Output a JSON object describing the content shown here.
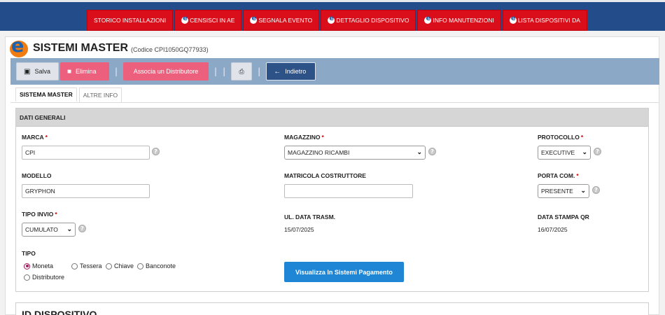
{
  "nav": [
    {
      "label": "STORICO INSTALLAZIONI",
      "has_logo": false
    },
    {
      "label": "CENSISCI IN AE",
      "has_logo": true
    },
    {
      "label": "SEGNALA EVENTO",
      "has_logo": true
    },
    {
      "label": "DETTAGLIO DISPOSITIVO",
      "has_logo": true
    },
    {
      "label": "INFO MANUTENZIONI",
      "has_logo": true
    },
    {
      "label": "LISTA DISPOSITIVI DA",
      "has_logo": true
    }
  ],
  "page": {
    "title": "SISTEMI MASTER",
    "subtitle": "(Codice CPI1050GQ77933)"
  },
  "toolbar": {
    "save": "Salva",
    "delete": "Elimina",
    "associate": "Associa un Distributore",
    "back": "Indietro"
  },
  "tabs": [
    {
      "label": "SISTEMA MASTER",
      "active": true
    },
    {
      "label": "ALTRE INFO",
      "active": false
    }
  ],
  "panel": {
    "header": "DATI GENERALI",
    "marca": {
      "label": "MARCA",
      "required": "*",
      "value": "CPI"
    },
    "magazzino": {
      "label": "MAGAZZINO",
      "required": "*",
      "value": "MAGAZZINO RICAMBI"
    },
    "protocollo": {
      "label": "PROTOCOLLO",
      "required": "*",
      "value": "EXECUTIVE"
    },
    "modello": {
      "label": "MODELLO",
      "value": "GRYPHON"
    },
    "matricola": {
      "label": "MATRICOLA COSTRUTTORE",
      "value": ""
    },
    "porta": {
      "label": "PORTA COM.",
      "required": "*",
      "value": "PRESENTE"
    },
    "tipo_invio": {
      "label": "TIPO INVIO",
      "required": "*",
      "value": "CUMULATO"
    },
    "ul_data": {
      "label": "UL. DATA TRASM.",
      "value": "15/07/2025"
    },
    "data_qr": {
      "label": "DATA STAMPA QR",
      "value": "16/07/2025"
    },
    "tipo": {
      "label": "TIPO",
      "options": [
        "Moneta",
        "Tessera",
        "Chiave",
        "Banconote",
        "Distributore"
      ],
      "selected": "Moneta"
    },
    "viz_button": "Visualizza In Sistemi Pagamento",
    "help_glyph": "?"
  },
  "panel2": {
    "header": "ID DISPOSITIVO"
  },
  "colors": {
    "nav_bg": "#234d8a",
    "nav_item": "#d90e1a",
    "toolbar": "#8ba9c7",
    "danger": "#ec5f7d",
    "primary": "#2d5288",
    "action": "#1f86d6"
  }
}
